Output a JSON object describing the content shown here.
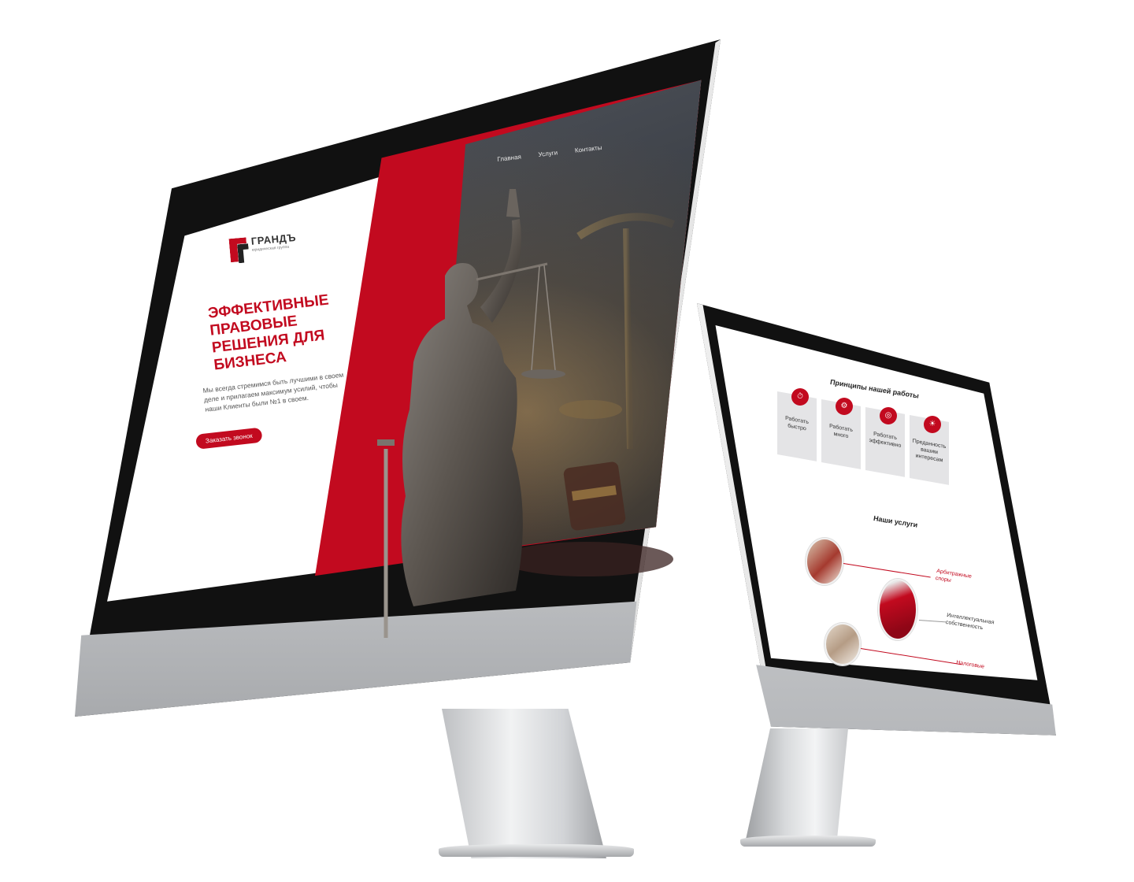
{
  "desktop": {
    "logo": {
      "name": "ГРАНДЪ",
      "subtitle": "юридическая группа"
    },
    "nav": {
      "items": [
        "Главная",
        "Услуги",
        "Контакты"
      ]
    },
    "hero": {
      "title": "ЭФФЕКТИВНЫЕ ПРАВОВЫЕ РЕШЕНИЯ ДЛЯ БИЗНЕСА",
      "text": "Мы всегда стремимся быть лучшими в своем деле и прилагаем максимум усилий, чтобы наши Клиенты были №1 в своем.",
      "cta_label": "Заказать звонок"
    }
  },
  "tablet": {
    "principles": {
      "title": "Принципы нашей работы",
      "cards": [
        {
          "label": "Работать быстро",
          "icon": "stopwatch-icon"
        },
        {
          "label": "Работать много",
          "icon": "gear-icon"
        },
        {
          "label": "Работать эффективно",
          "icon": "target-icon"
        },
        {
          "label": "Преданность вашим интересам",
          "icon": "sun-icon"
        }
      ]
    },
    "services": {
      "title": "Наши услуги",
      "items": [
        "Арбитражные споры",
        "Интеллектуальная собственность",
        "Налоговые"
      ]
    }
  },
  "colors": {
    "accent": "#c20a1f",
    "card_bg": "#e4e4e6",
    "bezel": "#111111"
  }
}
